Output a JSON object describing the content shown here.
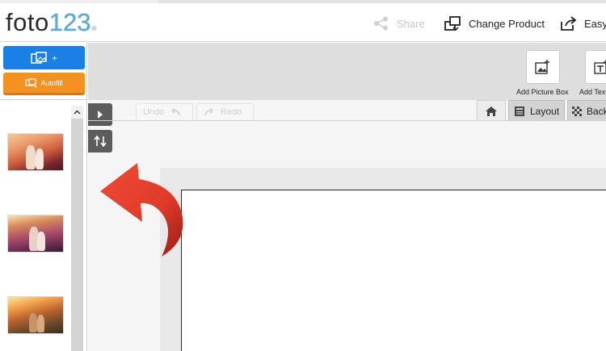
{
  "app": {
    "title": "foto123"
  },
  "header": {
    "logo_word": "foto",
    "logo_number": "123",
    "logo_mark": "®",
    "share_label": "Share",
    "change_product_label": "Change Product",
    "easy_label": "Easy"
  },
  "sidebar": {
    "upload_label": "+",
    "autofill_label": "Autofill",
    "thumbnails": [
      {
        "icon": "photo-couple-sunset"
      },
      {
        "icon": "photo-couple-field"
      },
      {
        "icon": "photo-couple-road"
      }
    ]
  },
  "toolbar": {
    "add_picture_box_label": "Add Picture Box",
    "add_text_label": "Add Text"
  },
  "canvas": {
    "undo_label": "Undo",
    "redo_label": "Redo",
    "tabs": {
      "layout_label": "Layout",
      "back_label": "Back"
    }
  },
  "colors": {
    "upload_button": "#1a80e6",
    "autofill_button": "#f39221",
    "logo_accent": "#5fa8d6",
    "arrow": "#e03a2a"
  }
}
